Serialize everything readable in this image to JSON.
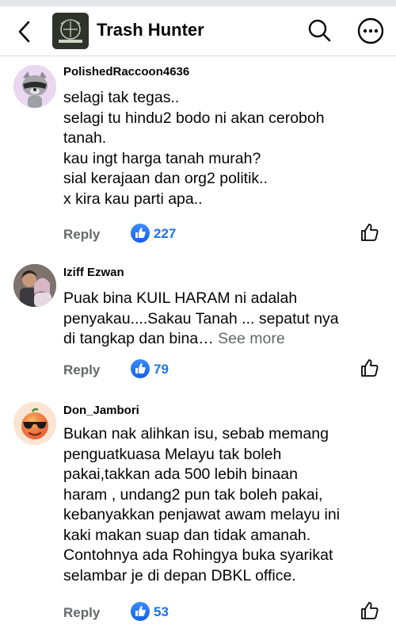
{
  "header": {
    "title": "Trash Hunter",
    "logo_text": "TRASH HUNTER"
  },
  "comments": [
    {
      "author": "PolishedRaccoon4636",
      "lines": [
        "selagi tak tegas..",
        "selagi tu hindu2 bodo ni akan ceroboh",
        "tanah.",
        "kau ingt harga tanah murah?",
        "sial kerajaan dan org2 politik..",
        "x kira kau parti apa.."
      ],
      "reply_label": "Reply",
      "likes": "227"
    },
    {
      "author": "Iziff Ezwan",
      "lines": [
        "Puak bina KUIL HARAM ni adalah",
        "penyakau....Sakau Tanah ... sepatut nya",
        "di tangkap dan bina…"
      ],
      "see_more": "See more",
      "reply_label": "Reply",
      "likes": "79"
    },
    {
      "author": "Don_Jambori",
      "lines": [
        "Bukan nak alihkan isu, sebab memang",
        "penguatkuasa Melayu tak boleh",
        "pakai,takkan ada 500 lebih binaan",
        "haram , undang2 pun tak boleh pakai,",
        "kebanyakkan penjawat awam melayu ini",
        "kaki makan suap dan tidak amanah.",
        "Contohnya ada Rohingya buka syarikat",
        "selambar je di depan DBKL office."
      ],
      "reply_label": "Reply",
      "likes": "53"
    }
  ],
  "colors": {
    "like_blue": "#1b74e4",
    "muted": "#65676b"
  }
}
